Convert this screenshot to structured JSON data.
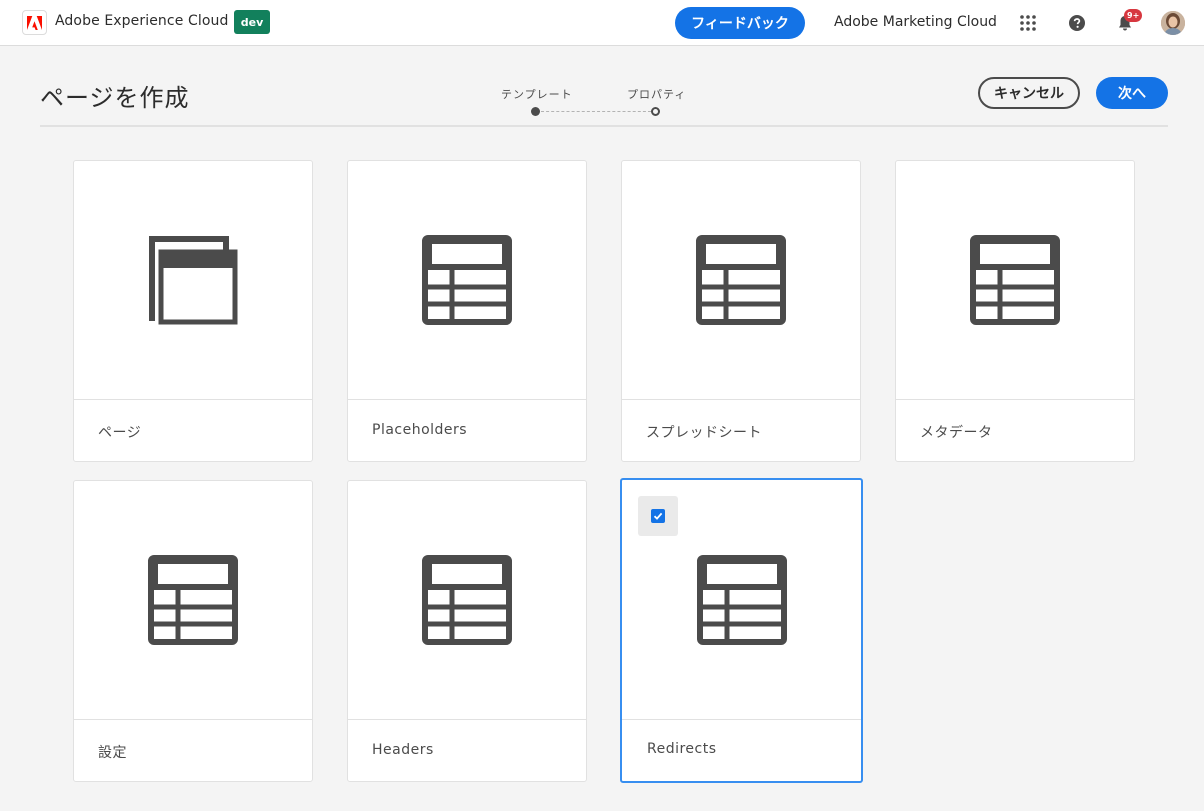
{
  "header": {
    "brand_name": "Adobe Experience Cloud",
    "env_badge": "dev",
    "feedback_label": "フィードバック",
    "org_name": "Adobe Marketing Cloud",
    "notification_count": "9+",
    "icons": [
      "adobe-logo-icon",
      "apps-grid-icon",
      "help-icon",
      "bell-icon",
      "avatar"
    ],
    "accent_color": "#1473e6",
    "badge_color": "#12805c"
  },
  "wizard": {
    "title": "ページを作成",
    "steps": [
      {
        "label": "テンプレート",
        "state": "active"
      },
      {
        "label": "プロパティ",
        "state": "pending"
      }
    ],
    "cancel_label": "キャンセル",
    "next_label": "次へ"
  },
  "templates": [
    {
      "label": "ページ",
      "icon": "page-template-icon",
      "selected": false
    },
    {
      "label": "Placeholders",
      "icon": "table-template-icon",
      "selected": false
    },
    {
      "label": "スプレッドシート",
      "icon": "table-template-icon",
      "selected": false
    },
    {
      "label": "メタデータ",
      "icon": "table-template-icon",
      "selected": false
    },
    {
      "label": "設定",
      "icon": "table-template-icon",
      "selected": false
    },
    {
      "label": "Headers",
      "icon": "table-template-icon",
      "selected": false
    },
    {
      "label": "Redirects",
      "icon": "table-template-icon",
      "selected": true
    }
  ]
}
